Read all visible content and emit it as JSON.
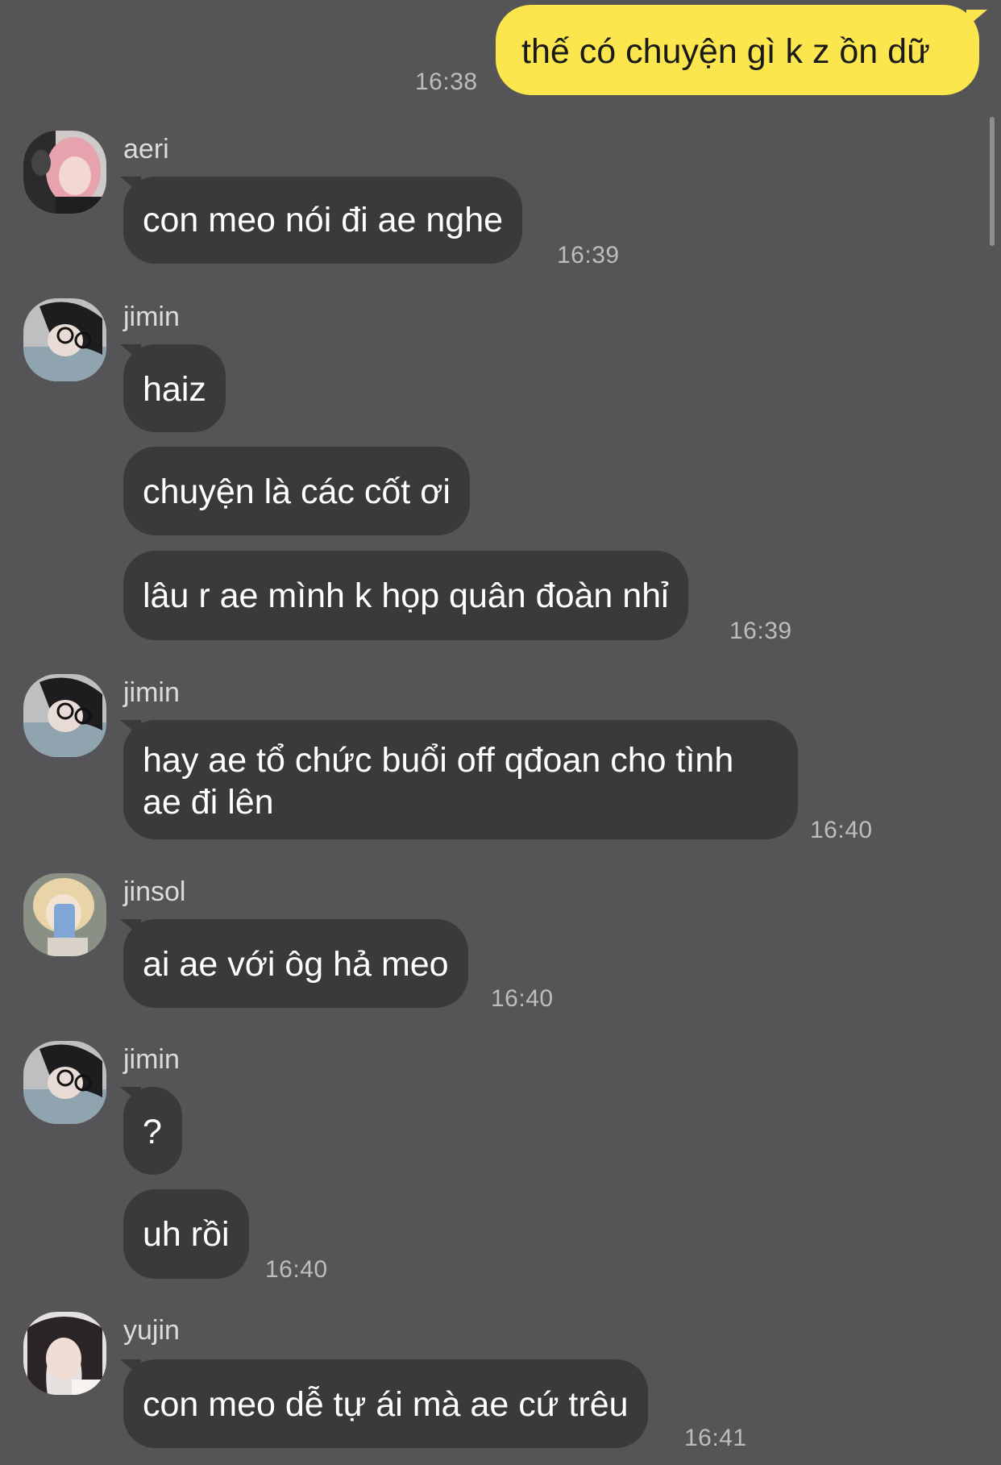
{
  "outgoing": [
    {
      "text": "thế có chuyện gì k z ồn dữ",
      "time": "16:38"
    }
  ],
  "groups": [
    {
      "sender": "aeri",
      "avatar_icon": "pink-hair-person-icon",
      "messages": [
        "con meo nói đi ae nghe"
      ],
      "time": "16:39"
    },
    {
      "sender": "jimin",
      "avatar_icon": "glasses-person-icon",
      "messages": [
        "haiz",
        "chuyện là các cốt ơi",
        "lâu r ae mình k họp quân đoàn nhỉ"
      ],
      "time": "16:39"
    },
    {
      "sender": "jimin",
      "avatar_icon": "glasses-person-icon",
      "messages": [
        "hay ae tổ chức buổi off qđoan cho tình ae đi lên"
      ],
      "time": "16:40"
    },
    {
      "sender": "jinsol",
      "avatar_icon": "selfie-phone-person-icon",
      "messages": [
        "ai ae với ôg hả meo"
      ],
      "time": "16:40"
    },
    {
      "sender": "jimin",
      "avatar_icon": "glasses-person-icon",
      "messages": [
        "?",
        "uh rồi"
      ],
      "time": "16:40"
    },
    {
      "sender": "yujin",
      "avatar_icon": "dark-hair-person-icon",
      "messages": [
        "con meo dễ tự ái mà ae cứ trêu"
      ],
      "time": "16:41"
    }
  ],
  "colors": {
    "background": "#555456",
    "outgoing_bubble": "#fbe64d",
    "incoming_bubble": "#3a393c",
    "timestamp": "#bdbcbf"
  }
}
